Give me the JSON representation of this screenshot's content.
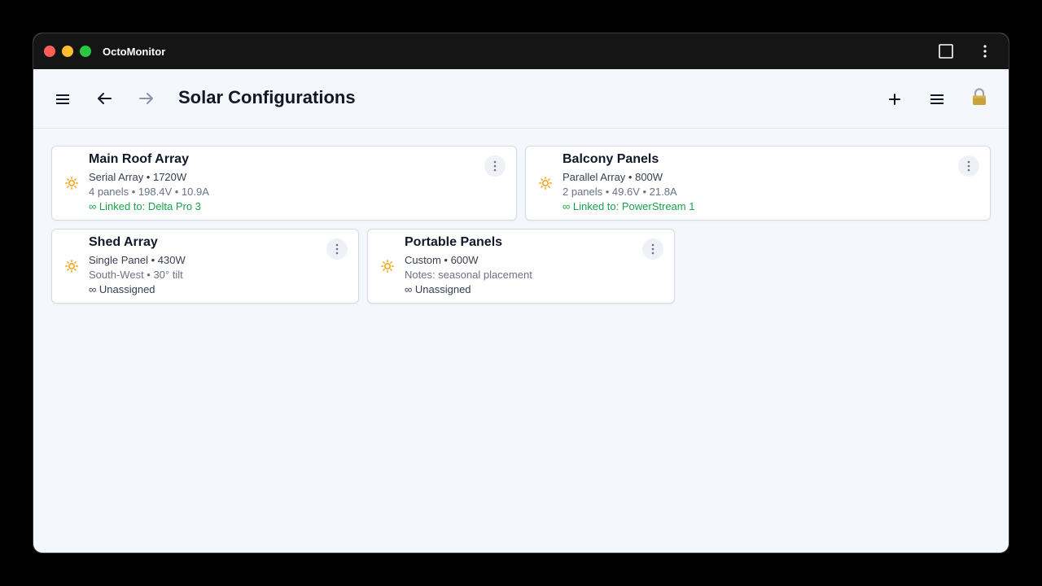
{
  "app": {
    "title": "OctoMonitor"
  },
  "toolbar": {
    "page_title": "Solar Configurations"
  },
  "icons": {
    "menu": "hamburger-menu-icon",
    "back": "arrow-left-icon",
    "forward": "arrow-right-icon",
    "add": "plus-icon",
    "list": "list-icon",
    "lock": "padlock-icon",
    "window": "window-square-icon",
    "more": "vertical-ellipsis-icon",
    "sun": "sun-icon"
  },
  "colors": {
    "linked": "#16a34a",
    "sun": "#f59e0b",
    "forward_disabled": "#8a94a6"
  },
  "cards": [
    {
      "title": "Main Roof Array",
      "line1": "Serial Array • 1720W",
      "line2": "4 panels • 198.4V • 10.9A",
      "line3": "∞ Linked to: Delta Pro 3",
      "linked": true
    },
    {
      "title": "Balcony Panels",
      "line1": "Parallel Array • 800W",
      "line2": "2 panels • 49.6V • 21.8A",
      "line3": "∞ Linked to: PowerStream 1",
      "linked": true
    },
    {
      "title": "Shed Array",
      "line1": "Single Panel • 430W",
      "line2": "South-West • 30° tilt",
      "line3": "∞ Unassigned",
      "linked": false
    },
    {
      "title": "Portable Panels",
      "line1": "Custom • 600W",
      "line2": "Notes: seasonal placement",
      "line3": "∞ Unassigned",
      "linked": false
    }
  ]
}
